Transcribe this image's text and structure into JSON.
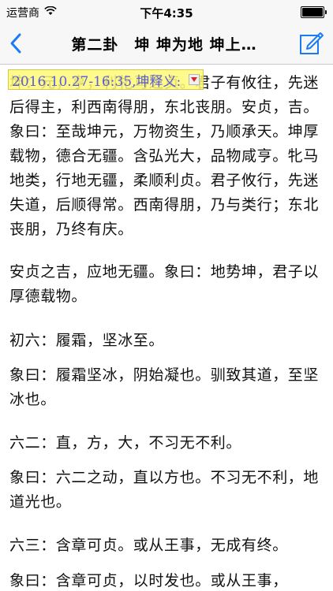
{
  "status_bar": {
    "carrier": "运营商",
    "time": "下午4:35",
    "battery_percent": 100
  },
  "nav": {
    "title": "第二卦　坤 坤为地 坤上…",
    "back_icon": "chevron-left-icon",
    "edit_icon": "compose-icon"
  },
  "colors": {
    "accent": "#1a7cf5",
    "note_bg": "#fff978",
    "note_text": "#5b5bd6"
  },
  "note_tag": {
    "label": "2016.10.27-16:35,坤释义:"
  },
  "paragraphs": [
    "坤：元，亨，利牝马之贞。君子有攸往，先迷后得主，利西南得朋，东北丧朋。安贞，吉。象曰：至哉坤元，万物资生，乃顺承天。坤厚载物，德合无疆。含弘光大，品物咸亨。牝马地类，行地无疆，柔顺利贞。君子攸行，先迷失道，后顺得常。西南得朋，乃与类行；东北丧朋，乃终有庆。",
    "安贞之吉，应地无疆。象曰：地势坤，君子以厚德载物。",
    "初六：履霜，坚冰至。",
    "象曰：履霜坚冰，阴始凝也。驯致其道，至坚冰也。",
    "六二：直，方，大，不习无不利。",
    "象曰：六二之动，直以方也。不习无不利，地道光也。",
    "六三：含章可贞。或从王事，无成有终。",
    "象曰：含章可贞，以时发也。或从王事，"
  ]
}
